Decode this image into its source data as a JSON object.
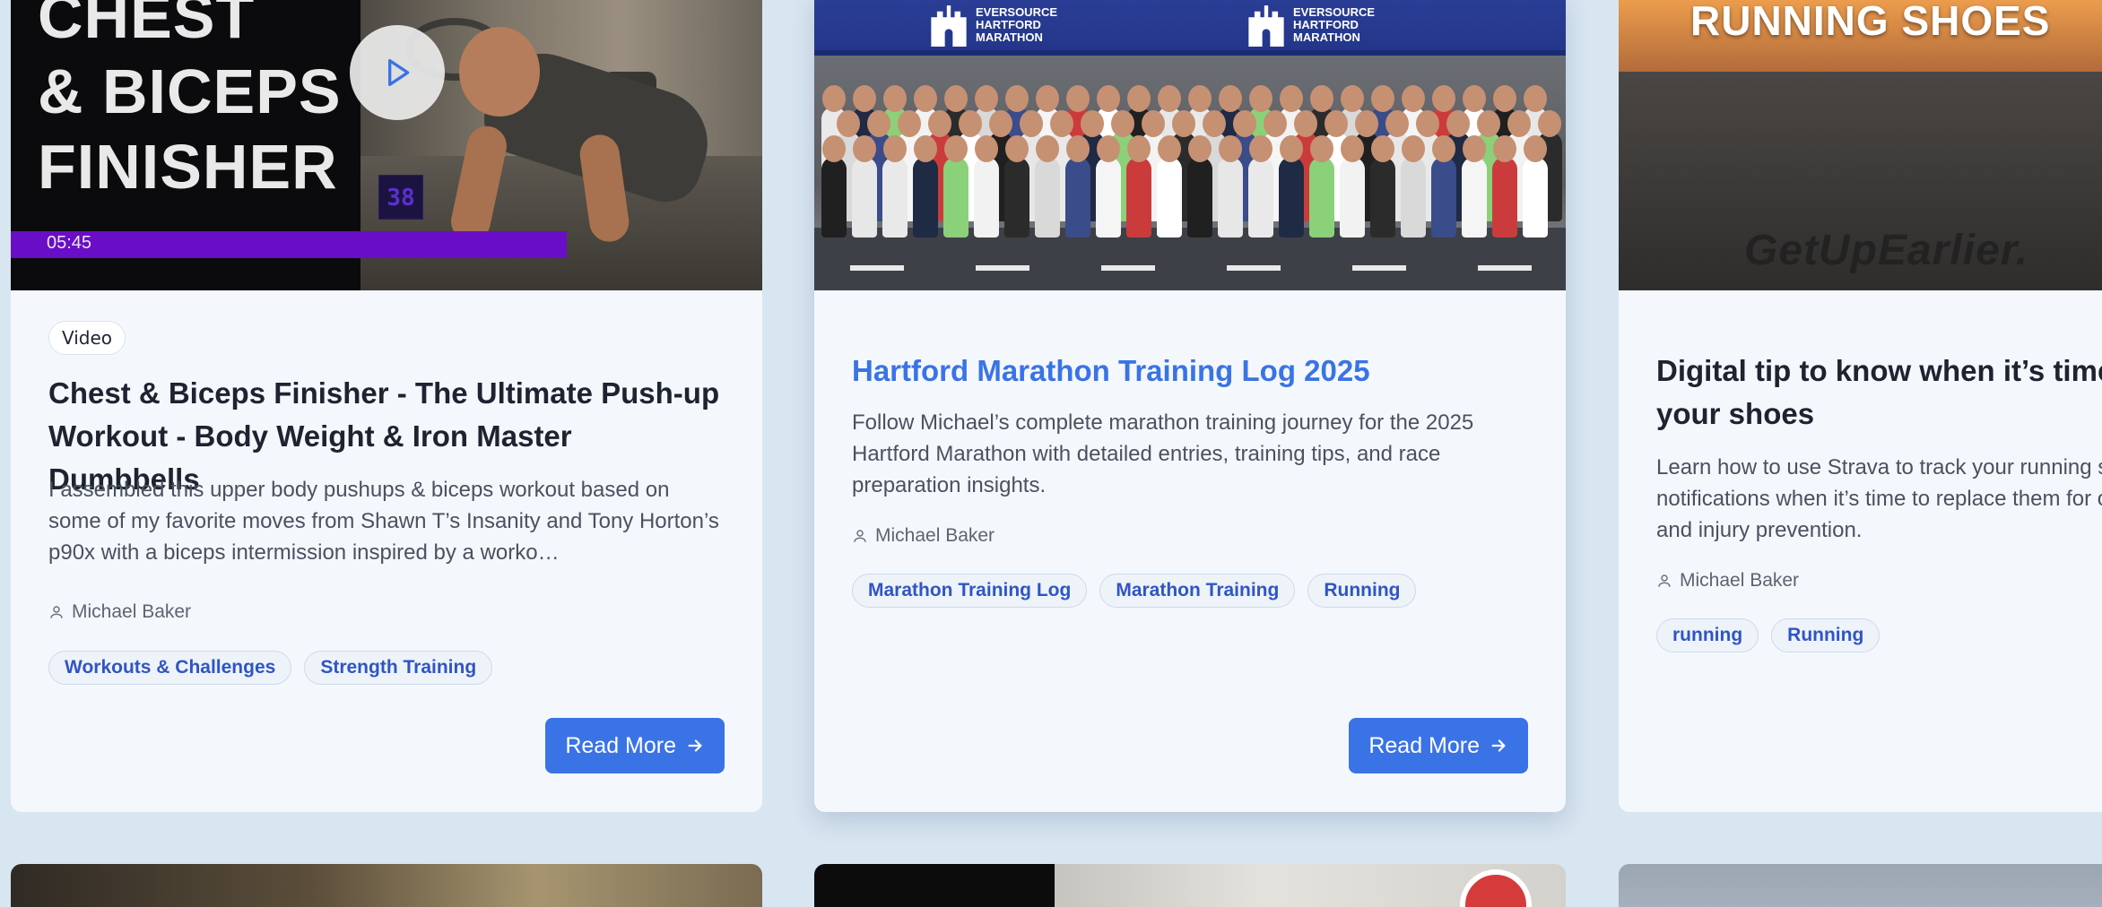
{
  "cards": [
    {
      "thumbnail": {
        "overlay_title": "CHEST\n& BICEPS\nFINISHER",
        "duration": "05:45",
        "counter": "38",
        "progress_percent": 74
      },
      "type_badge": "Video",
      "title": "Chest & Biceps Finisher - The Ultimate Push-up Workout - Body Weight & Iron Master Dumbbells",
      "excerpt": "I assembled this upper body pushups & biceps workout based on some of my favorite moves from Shawn T’s Insanity and Tony Horton’s p90x with a biceps intermission inspired by a worko…",
      "author": "Michael Baker",
      "tags": [
        "Workouts & Challenges",
        "Strength Training"
      ],
      "read_more_label": "Read More"
    },
    {
      "thumbnail": {
        "banner_logo_line1": "EVERSOURCE",
        "banner_logo_line2": "HARTFORD",
        "banner_logo_line3": "MARATHON"
      },
      "title": "Hartford Marathon Training Log 2025",
      "excerpt": "Follow Michael’s complete marathon training journey for the 2025 Hartford Marathon with detailed entries, training tips, and race preparation insights.",
      "author": "Michael Baker",
      "tags": [
        "Marathon Training Log",
        "Marathon Training",
        "Running"
      ],
      "read_more_label": "Read More"
    },
    {
      "thumbnail": {
        "headline": "RUNNING SHOES",
        "watermark": "GetUpEarlier."
      },
      "title": "Digital tip to know when it’s time to replace your shoes",
      "excerpt": "Learn how to use Strava to track your running shoes and get notifications when it’s time to replace them for optimal performance and injury prevention.",
      "author": "Michael Baker",
      "tags": [
        "running",
        "Running"
      ]
    }
  ],
  "colors": {
    "page_background": "#d8e6f1",
    "card_background": "#f4f8fc",
    "accent": "#3a73e6",
    "tag_text": "#2f55c4",
    "title_text": "#1d2330",
    "video_progress": "#6a0dc7"
  },
  "icons": {
    "play": "play-icon",
    "author": "user-icon",
    "arrow": "arrow-right-icon"
  }
}
